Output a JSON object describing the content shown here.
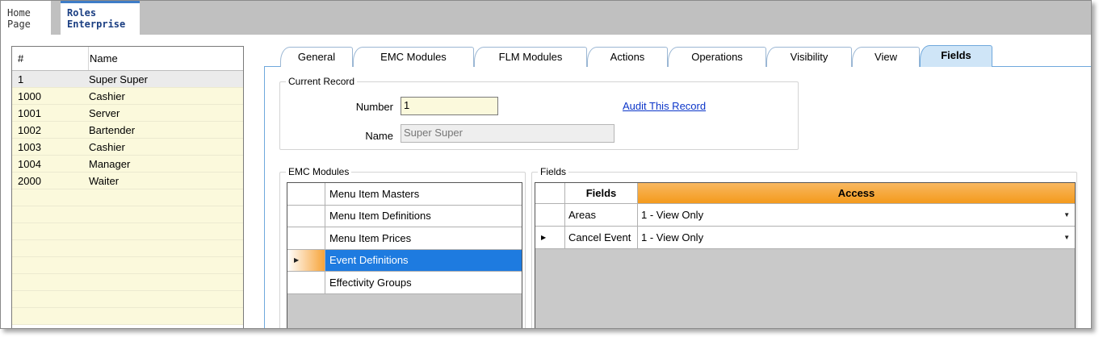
{
  "top_tabs": [
    {
      "line1": "Home",
      "line2": "Page"
    },
    {
      "line1": "Roles",
      "line2": "Enterprise"
    }
  ],
  "left_list": {
    "columns": [
      "#",
      "Name"
    ],
    "rows": [
      {
        "num": "1",
        "name": "Super Super"
      },
      {
        "num": "1000",
        "name": "Cashier"
      },
      {
        "num": "1001",
        "name": "Server"
      },
      {
        "num": "1002",
        "name": "Bartender"
      },
      {
        "num": "1003",
        "name": "Cashier"
      },
      {
        "num": "1004",
        "name": "Manager"
      },
      {
        "num": "2000",
        "name": "Waiter"
      }
    ]
  },
  "tabs": [
    "General",
    "EMC Modules",
    "FLM Modules",
    "Actions",
    "Operations",
    "Visibility",
    "View",
    "Fields"
  ],
  "current_record": {
    "legend": "Current Record",
    "number_label": "Number",
    "number_value": "1",
    "name_label": "Name",
    "name_value": "Super Super",
    "audit_link": "Audit This Record"
  },
  "emc_modules": {
    "legend": "EMC Modules",
    "items": [
      "Menu Item Masters",
      "Menu Item Definitions",
      "Menu Item Prices",
      "Event Definitions",
      "Effectivity Groups"
    ]
  },
  "fields": {
    "legend": "Fields",
    "columns": [
      "Fields",
      "Access"
    ],
    "rows": [
      {
        "field": "Areas",
        "access": "1 - View Only"
      },
      {
        "field": "Cancel Event",
        "access": "1 - View Only"
      }
    ]
  },
  "colors": {
    "accent_orange": "#f49a1c",
    "selection_blue": "#1e7be0",
    "list_yellow": "#fbf9dc",
    "active_tab": "#cfe5f7"
  }
}
